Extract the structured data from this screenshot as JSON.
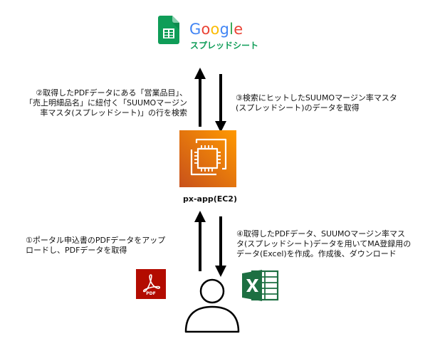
{
  "sheets_logo": {
    "brand_letters": [
      {
        "char": "G",
        "color": "#4285F4"
      },
      {
        "char": "o",
        "color": "#EA4335"
      },
      {
        "char": "o",
        "color": "#FBBC05"
      },
      {
        "char": "g",
        "color": "#4285F4"
      },
      {
        "char": "l",
        "color": "#34A853"
      },
      {
        "char": "e",
        "color": "#EA4335"
      }
    ],
    "product": "スプレッドシート",
    "icon": "google-sheets-icon",
    "color": "#0F9D58"
  },
  "ec2": {
    "label": "px-app(EC2)",
    "icon": "ec2-chip-icon",
    "colors": [
      "#C8511B",
      "#FF9900"
    ]
  },
  "notes": {
    "step1": "①ポータル申込書のPDFデータをアップ\nロードし、PDFデータを取得",
    "step2": "②取得したPDFデータにある「営業品目」、\n「売上明細品名」に紐付く「SUUMOマージン\n率マスタ(スプレッドシート)」の行を検索",
    "step3": "③検索にヒットしたSUUMOマージン率マスタ\n(スプレッドシート)のデータを取得",
    "step4": "④取得したPDFデータ、SUUMOマージン率マス\nタ(スプレッドシート)データを用いてMA登録用の\nデータ(Excel)を作成。作成後、ダウンロード"
  },
  "pdf_icon": {
    "text": "PDF",
    "icon": "pdf-file-icon",
    "color": "#B30B00"
  },
  "excel_icon": {
    "icon": "excel-icon",
    "color": "#1D6F42"
  },
  "user": {
    "icon": "user-icon"
  }
}
